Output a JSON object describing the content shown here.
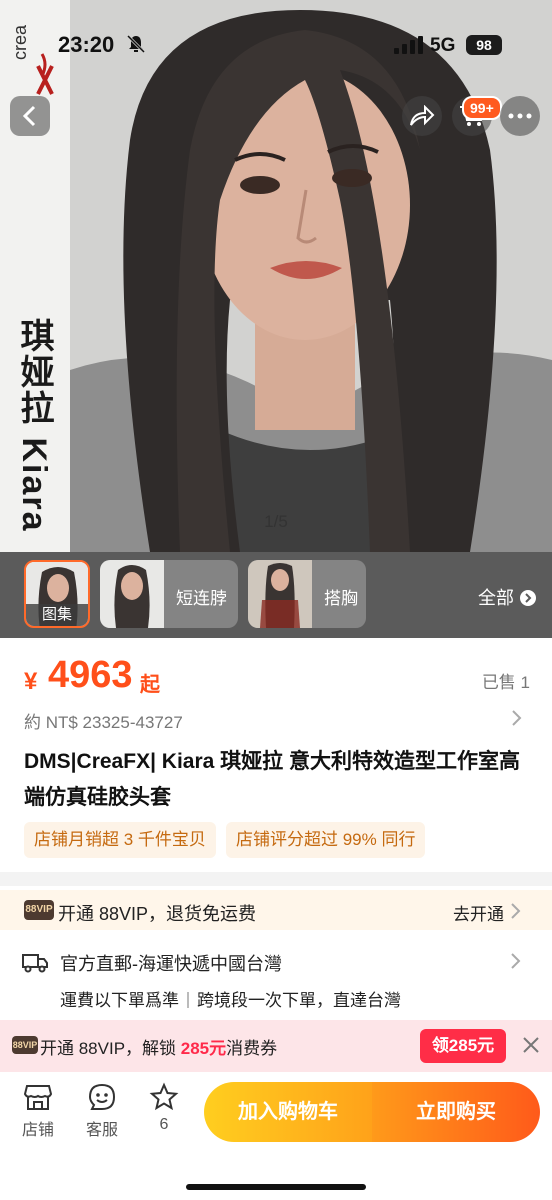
{
  "status_bar": {
    "time": "23:20",
    "network": "5G",
    "battery": "98"
  },
  "hero": {
    "brand_logo_text": "creaFX",
    "vertical_title": "琪娅拉 Kiara",
    "image_counter": "1/5",
    "cart_badge": "99+"
  },
  "thumbnails": {
    "items": [
      {
        "label": "图集",
        "active": true
      },
      {
        "label": "短连脖",
        "active": false
      },
      {
        "label": "搭胸",
        "active": false
      }
    ],
    "all_label": "全部"
  },
  "price": {
    "symbol": "¥",
    "value": "4963",
    "suffix": "起",
    "sold": "已售 1",
    "converted": "約 NT$ 23325-43727"
  },
  "product": {
    "title": "DMS|CreaFX| Kiara 琪娅拉 意大利特效造型工作室高端仿真硅胶头套",
    "tags": [
      "店铺月销超 3 千件宝贝",
      "店铺评分超过 99% 同行"
    ]
  },
  "vip": {
    "logo": "88VIP",
    "text": "开通 88VIP，退货免运费",
    "action": "去开通"
  },
  "shipping": {
    "title": "官方直郵-海運快遞中國台灣",
    "detail_1": "運費以下單爲準",
    "detail_2": "跨境段一次下單，直達台灣"
  },
  "coupon": {
    "logo": "88VIP",
    "text_before": "开通 88VIP，解锁 ",
    "amount": "285元",
    "text_after": "消费券",
    "claim": "领285元"
  },
  "bottom_bar": {
    "store": "店铺",
    "service": "客服",
    "favorites": "6",
    "add_to_cart": "加入购物车",
    "buy_now": "立即购买"
  },
  "colors": {
    "accent": "#ff4f1a",
    "coupon_red": "#ff2d47",
    "cart_yellow": "#ffb51f"
  }
}
